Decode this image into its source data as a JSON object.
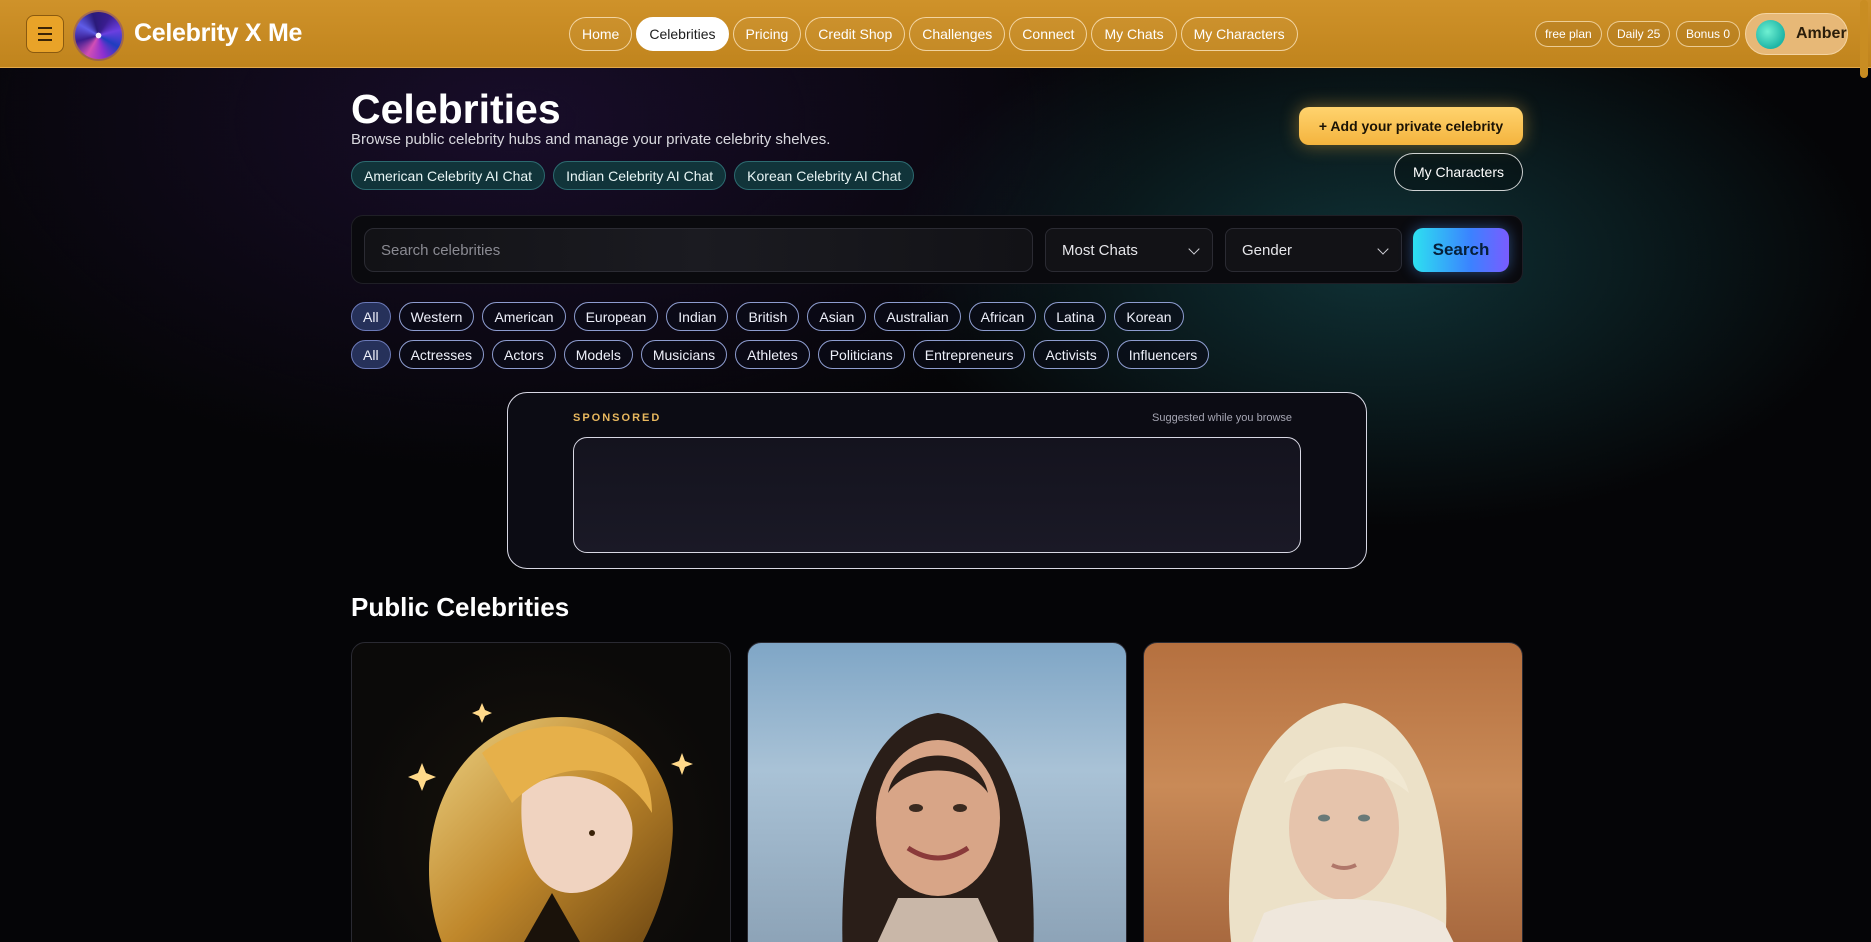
{
  "header": {
    "brand": "Celebrity X Me",
    "menu_icon": "hamburger-icon",
    "logo_icon": "swirl-logo",
    "nav": [
      {
        "label": "Home",
        "active": false
      },
      {
        "label": "Celebrities",
        "active": true
      },
      {
        "label": "Pricing",
        "active": false
      },
      {
        "label": "Credit Shop",
        "active": false
      },
      {
        "label": "Challenges",
        "active": false
      },
      {
        "label": "Connect",
        "active": false
      },
      {
        "label": "My Chats",
        "active": false
      },
      {
        "label": "My Characters",
        "active": false
      }
    ],
    "plan": "free plan",
    "daily": "Daily 25",
    "bonus": "Bonus 0",
    "user_name": "Amber",
    "accent": "#c98d22"
  },
  "page": {
    "title": "Celebrities",
    "subtitle": "Browse public celebrity hubs and manage your private celebrity shelves.",
    "hubs": [
      "American Celebrity AI Chat",
      "Indian Celebrity AI Chat",
      "Korean Celebrity AI Chat"
    ],
    "add_button": "+ Add your private celebrity",
    "my_characters_button": "My Characters"
  },
  "search": {
    "placeholder": "Search celebrities",
    "sort_selected": "Most Chats",
    "gender_selected": "Gender",
    "button": "Search"
  },
  "filters": {
    "regions": [
      "All",
      "Western",
      "American",
      "European",
      "Indian",
      "British",
      "Asian",
      "Australian",
      "African",
      "Latina",
      "Korean"
    ],
    "categories": [
      "All",
      "Actresses",
      "Actors",
      "Models",
      "Musicians",
      "Athletes",
      "Politicians",
      "Entrepreneurs",
      "Activists",
      "Influencers"
    ]
  },
  "sponsored": {
    "label": "SPONSORED",
    "note": "Suggested while you browse"
  },
  "public": {
    "title": "Public Celebrities",
    "cards": [
      {
        "image": "golden-haired-anime-woman-portrait"
      },
      {
        "image": "dark-haired-woman-smiling-portrait"
      },
      {
        "image": "blonde-woman-portrait"
      }
    ]
  }
}
